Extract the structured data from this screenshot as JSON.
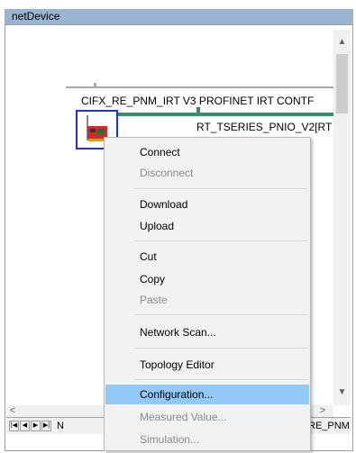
{
  "window": {
    "title": "netDevice"
  },
  "network": {
    "master_name": "CIFX_RE_PNM_IRT V3 PROFINET IRT CONTF",
    "slave_name": "RT_TSERIES_PNIO_V2[RT"
  },
  "context_menu": {
    "items": [
      {
        "label": "Connect",
        "enabled": true
      },
      {
        "label": "Disconnect",
        "enabled": false
      },
      {
        "label": "Download",
        "enabled": true
      },
      {
        "label": "Upload",
        "enabled": true
      },
      {
        "label": "Cut",
        "enabled": true
      },
      {
        "label": "Copy",
        "enabled": true
      },
      {
        "label": "Paste",
        "enabled": false
      },
      {
        "label": "Network Scan...",
        "enabled": true
      },
      {
        "label": "Topology Editor",
        "enabled": true
      },
      {
        "label": "Configuration...",
        "enabled": true,
        "highlighted": true
      },
      {
        "label": "Measured Value...",
        "enabled": false
      },
      {
        "label": "Simulation...",
        "enabled": false
      }
    ]
  },
  "tabs": {
    "left_label": "N",
    "right_label": "RE_PNM"
  },
  "icons": {
    "scroll_up": "▲",
    "scroll_down": "▼",
    "scroll_left": "<",
    "scroll_right": ">",
    "nav_first": "|◀",
    "nav_prev": "◀",
    "nav_next": "▶",
    "nav_last": "▶|"
  }
}
